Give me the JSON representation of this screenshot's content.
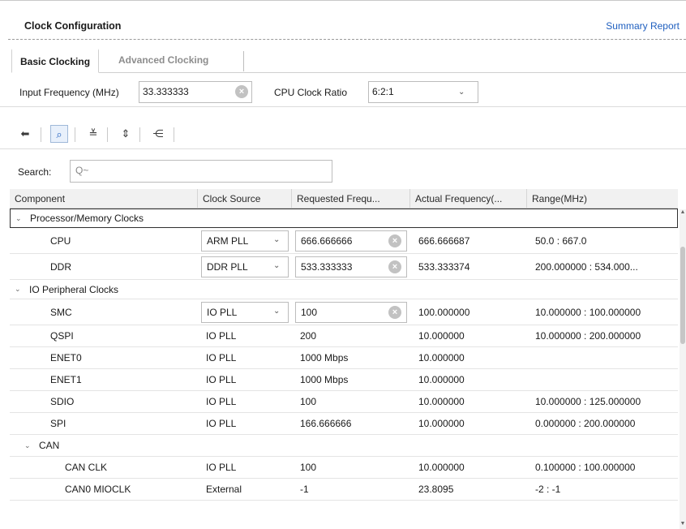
{
  "header": {
    "title": "Clock Configuration",
    "summary_link": "Summary Report"
  },
  "tabs": [
    {
      "label": "Basic Clocking",
      "active": true
    },
    {
      "label": "Advanced Clocking",
      "active": false
    }
  ],
  "inputs": {
    "input_freq_label": "Input Frequency (MHz)",
    "input_freq_value": "33.333333",
    "cpu_ratio_label": "CPU Clock Ratio",
    "cpu_ratio_value": "6:2:1"
  },
  "toolbar": {
    "icons": [
      "back-arrow-icon",
      "search-icon",
      "collapse-all-icon",
      "expand-all-icon",
      "hierarchy-icon"
    ]
  },
  "search": {
    "label": "Search:",
    "placeholder": "Q~"
  },
  "columns": [
    "Component",
    "Clock Source",
    "Requested Frequ...",
    "Actual Frequency(...",
    "Range(MHz)"
  ],
  "rows": [
    {
      "type": "group",
      "label": "Processor/Memory Clocks"
    },
    {
      "type": "item",
      "component": "CPU",
      "source": "ARM PLL",
      "source_dropdown": true,
      "requested": "666.666666",
      "requested_editable": true,
      "actual": "666.666687",
      "range": "50.0 : 667.0"
    },
    {
      "type": "item",
      "component": "DDR",
      "source": "DDR PLL",
      "source_dropdown": true,
      "requested": "533.333333",
      "requested_editable": true,
      "actual": "533.333374",
      "range": "200.000000 : 534.000..."
    },
    {
      "type": "group",
      "label": "IO Peripheral Clocks"
    },
    {
      "type": "item",
      "component": "SMC",
      "source": "IO PLL",
      "source_dropdown": true,
      "requested": "100",
      "requested_editable": true,
      "actual": "100.000000",
      "range": "10.000000 : 100.000000"
    },
    {
      "type": "item",
      "component": "QSPI",
      "source": "IO PLL",
      "requested": "200",
      "actual": "10.000000",
      "range": "10.000000 : 200.000000"
    },
    {
      "type": "item",
      "component": "ENET0",
      "source": "IO PLL",
      "requested": "1000 Mbps",
      "actual": "10.000000",
      "range": ""
    },
    {
      "type": "item",
      "component": "ENET1",
      "source": "IO PLL",
      "requested": "1000 Mbps",
      "actual": "10.000000",
      "range": ""
    },
    {
      "type": "item",
      "component": "SDIO",
      "source": "IO PLL",
      "requested": "100",
      "actual": "10.000000",
      "range": "10.000000 : 125.000000"
    },
    {
      "type": "item",
      "component": "SPI",
      "source": "IO PLL",
      "requested": "166.666666",
      "actual": "10.000000",
      "range": "0.000000 : 200.000000"
    },
    {
      "type": "subgroup",
      "label": "CAN"
    },
    {
      "type": "subitem",
      "component": "CAN CLK",
      "source": "IO PLL",
      "requested": "100",
      "actual": "10.000000",
      "range": "0.100000 : 100.000000"
    },
    {
      "type": "subitem",
      "component": "CAN0 MIOCLK",
      "source": "External",
      "requested": "-1",
      "actual": "23.8095",
      "range": "-2 : -1"
    }
  ]
}
